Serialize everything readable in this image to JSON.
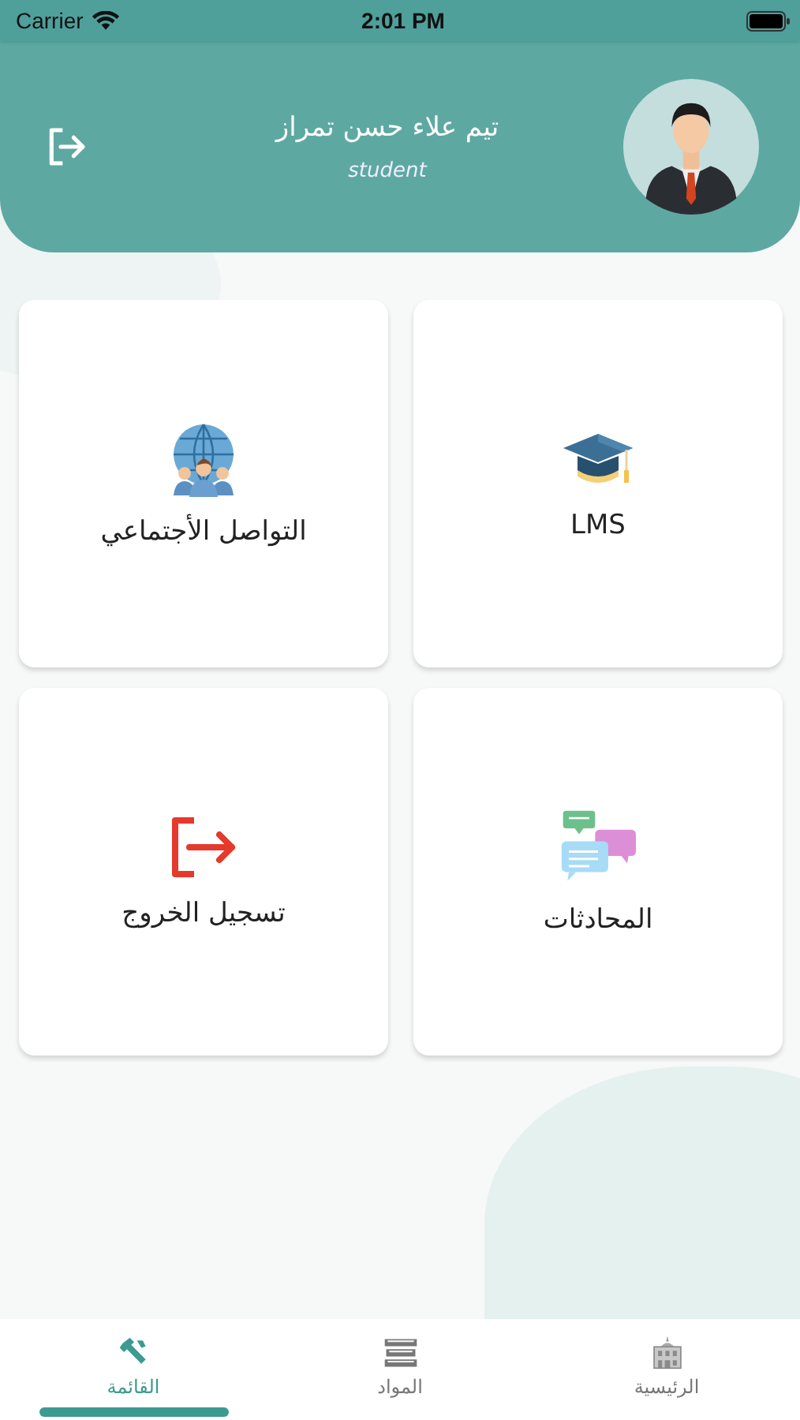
{
  "status_bar": {
    "carrier": "Carrier",
    "time": "2:01 PM"
  },
  "profile": {
    "name": "تيم علاء حسن تمراز",
    "role": "student"
  },
  "tiles": [
    {
      "kind": "lms",
      "label": "LMS"
    },
    {
      "kind": "social",
      "label": "التواصل الأجتماعي"
    },
    {
      "kind": "chats",
      "label": "المحادثات"
    },
    {
      "kind": "logout",
      "label": "تسجيل الخروج"
    }
  ],
  "tabs": [
    {
      "kind": "home",
      "label": "الرئيسية",
      "selected": false
    },
    {
      "kind": "subjects",
      "label": "المواد",
      "selected": false
    },
    {
      "kind": "menu",
      "label": "القائمة",
      "selected": true
    }
  ]
}
